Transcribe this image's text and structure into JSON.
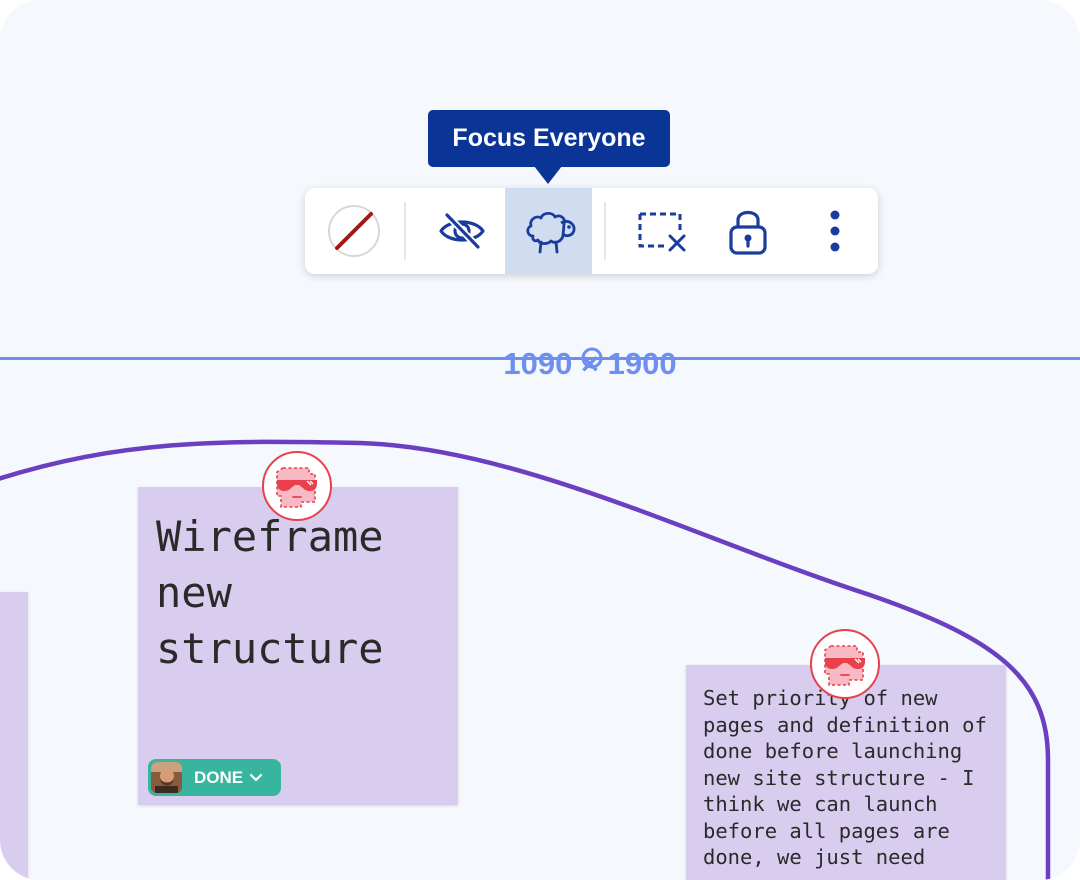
{
  "tooltip": {
    "text": "Focus Everyone"
  },
  "toolbar": {
    "buttons": [
      {
        "name": "no-color-swatch"
      },
      {
        "name": "hide-icon"
      },
      {
        "name": "sheep-icon",
        "active": true
      },
      {
        "name": "deselect-area-icon"
      },
      {
        "name": "lock-icon"
      },
      {
        "name": "more-vertical-icon"
      }
    ]
  },
  "dimension": {
    "label": "1090 × 1900"
  },
  "stickies": {
    "main": {
      "text": "Wireframe new structure"
    },
    "right": {
      "text": "Set priority of new pages and definition of done before launching new site structure - I think we can launch before all pages are done, we just need"
    }
  },
  "status_badge": {
    "label": "DONE"
  },
  "colors": {
    "accent": "#0a3596",
    "canvas": "#f5f8fc",
    "sticky": "#d8cdee",
    "frame_line": "#6a3fc0",
    "badge": "#37b59e",
    "sticker_red": "#e8404d"
  }
}
